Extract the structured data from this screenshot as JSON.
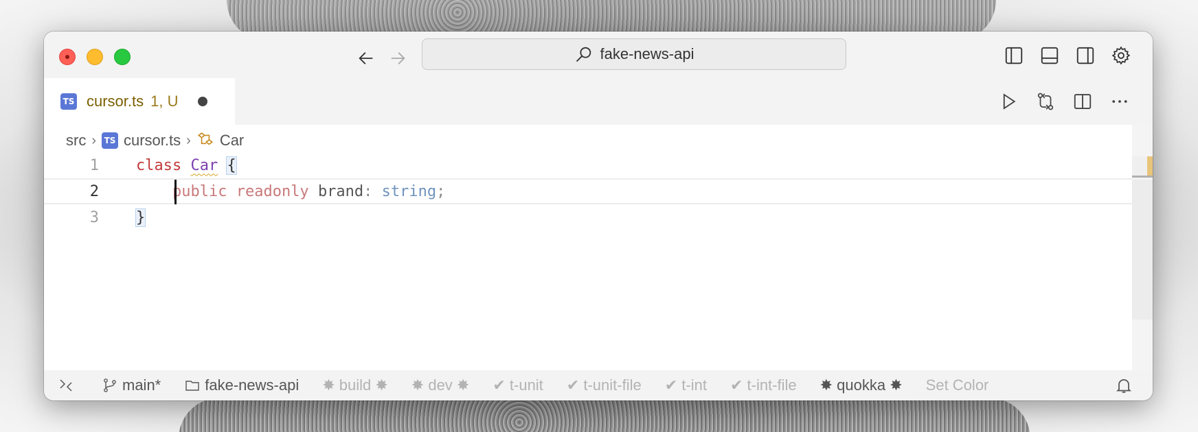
{
  "titlebar": {
    "search_text": "fake-news-api",
    "icons": [
      "arrow-left-icon",
      "arrow-right-icon",
      "search-icon",
      "toggle-primary-sidebar-icon",
      "toggle-panel-icon",
      "toggle-secondary-sidebar-icon",
      "gear-icon"
    ]
  },
  "tab": {
    "icon": "TS",
    "title": "cursor.ts",
    "status": "1, U",
    "actions": [
      "run-icon",
      "compare-changes-icon",
      "split-editor-icon",
      "more-icon"
    ]
  },
  "breadcrumb": {
    "folder": "src",
    "file_icon": "TS",
    "file": "cursor.ts",
    "symbol": "Car"
  },
  "code": {
    "lines": [
      {
        "number": "1",
        "tokens": {
          "keyword": "class",
          "name": "Car",
          "brace": "{"
        }
      },
      {
        "number": "2",
        "tokens": {
          "modifier1": "public",
          "modifier2": "readonly",
          "ident": "brand",
          "colon": ":",
          "type": "string",
          "semi": ";"
        }
      },
      {
        "number": "3",
        "tokens": {
          "brace": "}"
        }
      }
    ]
  },
  "statusbar": {
    "branch": "main*",
    "folder": "fake-news-api",
    "tasks": [
      {
        "label": "✸ build ✸",
        "dim": true
      },
      {
        "label": "✸ dev ✸",
        "dim": true
      },
      {
        "label": "✔ t-unit",
        "dim": true
      },
      {
        "label": "✔ t-unit-file",
        "dim": true
      },
      {
        "label": "✔ t-int",
        "dim": true
      },
      {
        "label": "✔ t-int-file",
        "dim": true
      },
      {
        "label": "✸ quokka ✸",
        "dim": false
      },
      {
        "label": "Set Color",
        "dim": true
      }
    ]
  },
  "colors": {
    "accent_tab_title": "#7a5e00",
    "keyword": "#c23a3a",
    "class_name": "#7b3fb0",
    "type": "#6f93bd"
  }
}
